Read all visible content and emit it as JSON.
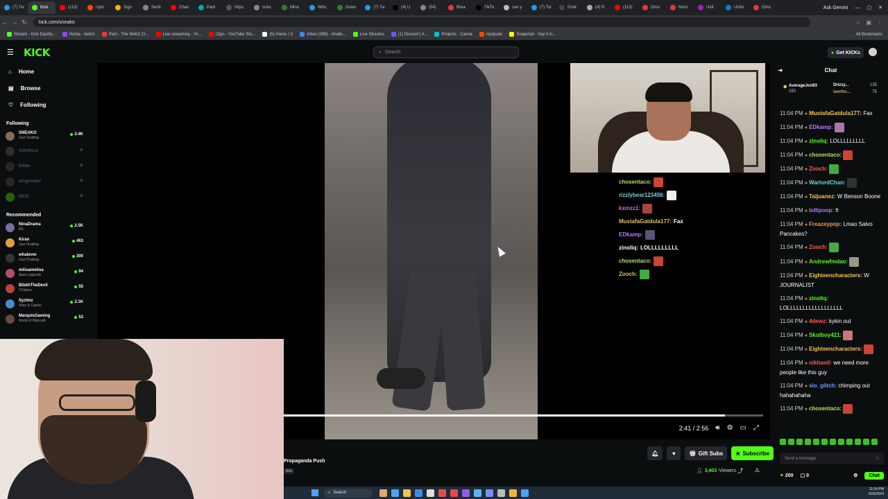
{
  "browser": {
    "tabs": [
      "(7) Tw",
      "Kick",
      "(113)",
      "r/pol",
      "Sign",
      "Senti",
      "Chan",
      "Parti",
      "https",
      "subs",
      "Mine",
      "Who",
      "Down",
      "(7) Tw",
      "(4) U",
      "(54)",
      "Brea",
      "TikTo",
      "can y",
      "(7) Tw",
      "Grok",
      "(4) R",
      "(113)",
      "Omo",
      "Moni",
      "Unit",
      "Unho",
      "Omo"
    ],
    "ask_gemini": "Ask Gemini",
    "url": "kick.com/sneako",
    "bookmarks": [
      "Stream - Kick Dashb...",
      "Home - twitch",
      "Parti - The Web3 Cr...",
      "Live streaming - Yo...",
      "Clips - YouTube Stu...",
      "(5) Home / X",
      "Inbox (399) - khalle...",
      "Live Streams",
      "(1) Discord | #...",
      "Projects - Canva",
      "r/popular",
      "Snapchat - Say it in..."
    ],
    "all_bookmarks": "All Bookmarks"
  },
  "header": {
    "logo": "KICK",
    "search_placeholder": "Search",
    "get_kicks": "Get KICKs"
  },
  "sidebar": {
    "nav": [
      {
        "label": "Home",
        "icon": "home-icon"
      },
      {
        "label": "Browse",
        "icon": "browse-icon"
      },
      {
        "label": "Following",
        "icon": "heart-icon"
      }
    ],
    "following_title": "Following",
    "following": [
      {
        "name": "SNEAKO",
        "game": "Just Chatting",
        "viewers": "3.4K",
        "live": true
      },
      {
        "name": "AdinRoss",
        "game": "",
        "viewers": "",
        "live": false
      },
      {
        "name": "Eddie",
        "game": "",
        "viewers": "",
        "live": false
      },
      {
        "name": "brugtroiber",
        "game": "",
        "viewers": "",
        "live": false
      },
      {
        "name": "KICK",
        "game": "",
        "viewers": "",
        "live": false
      }
    ],
    "recommended_title": "Recommended",
    "recommended": [
      {
        "name": "NinaDrama",
        "game": "IRL",
        "viewers": "2.5K"
      },
      {
        "name": "Kiran",
        "game": "Just Chatting",
        "viewers": "463"
      },
      {
        "name": "whatever",
        "game": "Just Chatting",
        "viewers": "300"
      },
      {
        "name": "miiisamelisa",
        "game": "Apex Legends",
        "viewers": "94"
      },
      {
        "name": "BilethTheDevil",
        "game": "VTubers",
        "viewers": "55"
      },
      {
        "name": "Syztmz",
        "game": "Slots & Casino",
        "viewers": "3.1K"
      },
      {
        "name": "MarquisGaming",
        "game": "World of Warcraft",
        "viewers": "53"
      }
    ]
  },
  "overlay_chat": [
    {
      "user": "chosentaco:",
      "text": "",
      "color": "#b5e06a"
    },
    {
      "user": "rizzlybear123456:",
      "text": "",
      "color": "#6ad6e0"
    },
    {
      "user": "kxmzz1:",
      "text": "",
      "color": "#d66ae0"
    },
    {
      "user": "MustafaGatdula177:",
      "text": "Fax",
      "color": "#e0c36a"
    },
    {
      "user": "EDkamp:",
      "text": "",
      "color": "#b57aff"
    },
    {
      "user": "zinoliq:",
      "text": "LOLLLLLLLLL",
      "color": "#ffffff"
    },
    {
      "user": "chosentaco:",
      "text": "",
      "color": "#b5e06a"
    },
    {
      "user": "Zooch:",
      "text": "",
      "color": "#e0c36a"
    }
  ],
  "player": {
    "time": "2:41 / 2:56",
    "progress": 0.92
  },
  "stream": {
    "title": "Propaganda Push",
    "tag": "tics",
    "viewers": "3,403",
    "viewers_label": "Viewers",
    "gift_subs": "Gift Subs",
    "subscribe": "Subscribe"
  },
  "chat": {
    "title": "Chat",
    "pinned": {
      "user": "AverageJon93",
      "coins": "150",
      "a": "Drizzy...",
      "b": "lamtho...",
      "n1": "135",
      "n2": "75"
    },
    "messages": [
      {
        "time": "11:04 PM",
        "user": "MustafaGatdula177:",
        "text": "Fax",
        "color": "#f2c94c"
      },
      {
        "time": "11:04 PM",
        "user": "EDkamp:",
        "text": "",
        "color": "#b57aff"
      },
      {
        "time": "11:04 PM",
        "user": "zinoliq:",
        "text": "LOLLLLLLLLL",
        "color": "#53fc18"
      },
      {
        "time": "11:04 PM",
        "user": "chosentaco:",
        "text": "",
        "color": "#b5e06a"
      },
      {
        "time": "11:04 PM",
        "user": "Zooch:",
        "text": "",
        "color": "#ff5b5b"
      },
      {
        "time": "11:04 PM",
        "user": "WarlordChan:",
        "text": "",
        "color": "#6ad6e0"
      },
      {
        "time": "11:04 PM",
        "user": "Taijuanez:",
        "text": "W Benson Boone",
        "color": "#f2c94c"
      },
      {
        "time": "11:04 PM",
        "user": "lollipoop:",
        "text": "fr",
        "color": "#b57aff"
      },
      {
        "time": "11:04 PM",
        "user": "Freazeypop:",
        "text": "Lmao Salvo Pancakes?",
        "color": "#f2994a"
      },
      {
        "time": "11:04 PM",
        "user": "Zooch:",
        "text": "",
        "color": "#ff5b5b"
      },
      {
        "time": "11:04 PM",
        "user": "Andrewfmdao:",
        "text": "",
        "color": "#53fc18"
      },
      {
        "time": "11:04 PM",
        "user": "Eighteencharacters:",
        "text": "W JOURNALIST",
        "color": "#f2c94c"
      },
      {
        "time": "11:04 PM",
        "user": "zinoliq:",
        "text": "LOLLLLLLLLLLLLLLLLLL",
        "color": "#53fc18"
      },
      {
        "time": "11:04 PM",
        "user": "4dewz:",
        "text": "kykin out",
        "color": "#ff5b5b"
      },
      {
        "time": "11:04 PM",
        "user": "Skolboy421:",
        "text": "",
        "color": "#53fc18"
      },
      {
        "time": "11:04 PM",
        "user": "Eighteencharacters:",
        "text": "",
        "color": "#f2c94c"
      },
      {
        "time": "11:04 PM",
        "user": "nikhanil:",
        "text": "we need more people like this guy",
        "color": "#ff5b5b"
      },
      {
        "time": "11:04 PM",
        "user": "slo_glitch:",
        "text": "chimping out hahahahaha",
        "color": "#6a9bff"
      },
      {
        "time": "11:04 PM",
        "user": "chosentaco:",
        "text": "",
        "color": "#b5e06a"
      }
    ],
    "send_placeholder": "Send a message",
    "kicks": "200",
    "points": "0",
    "chat_button": "Chat"
  },
  "taskbar": {
    "search": "Search",
    "time": "11:04 PM",
    "date": "3/26/2024"
  }
}
